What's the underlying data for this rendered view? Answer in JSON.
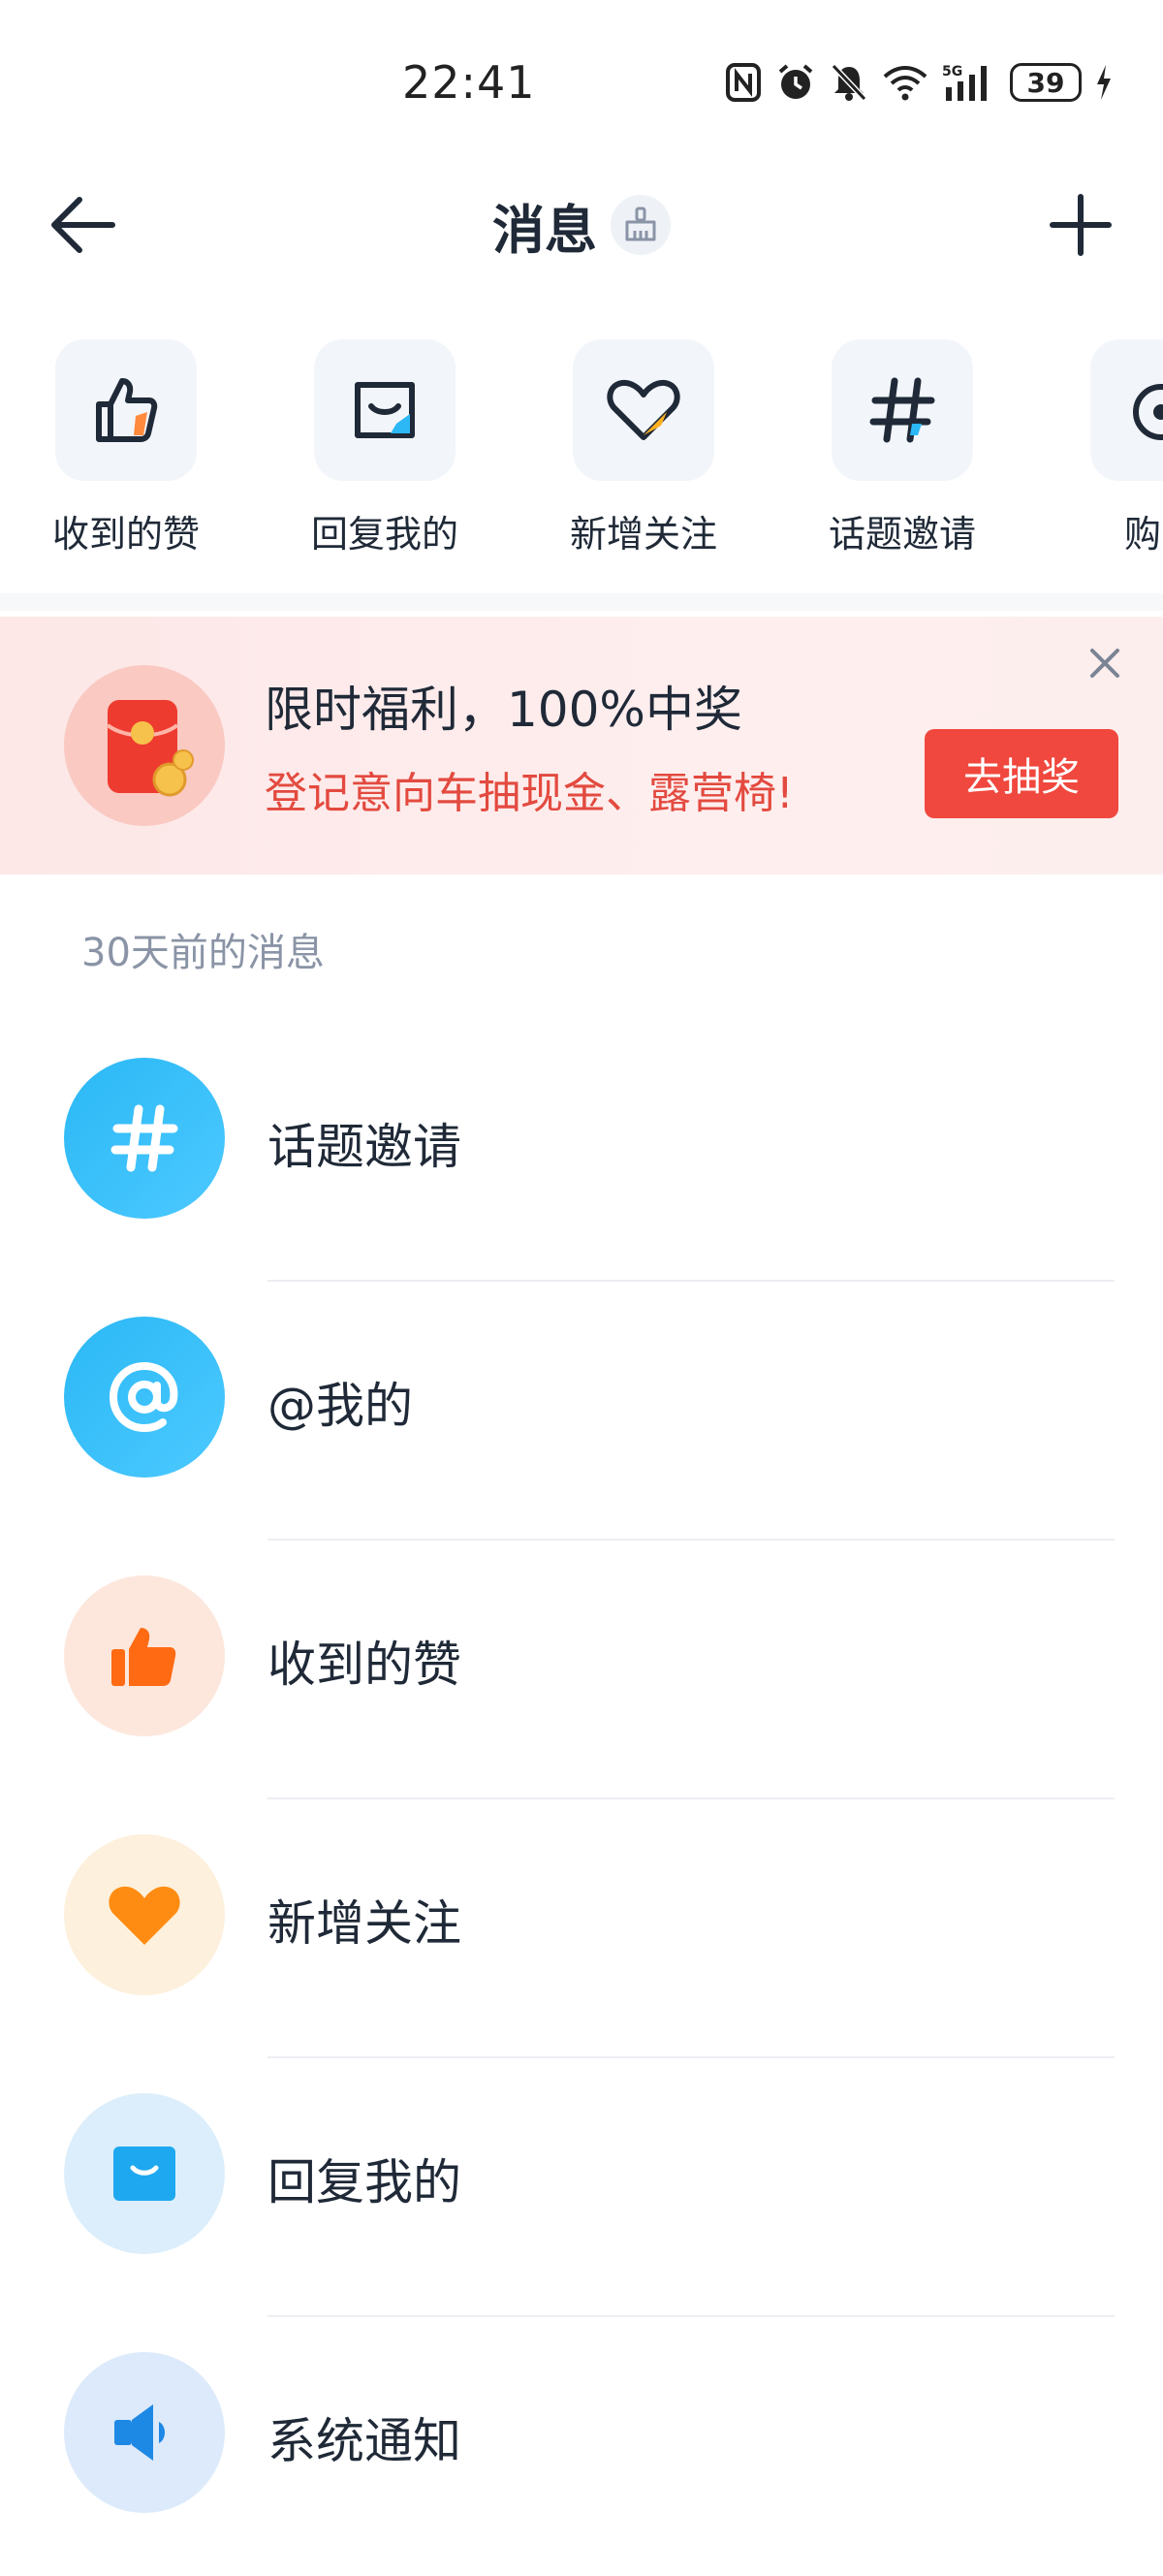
{
  "status_bar": {
    "time": "22:41",
    "battery": "39",
    "icons": [
      "nfc-icon",
      "alarm-icon",
      "mute-icon",
      "wifi-icon",
      "signal-5g-icon",
      "battery-icon",
      "charging-icon"
    ]
  },
  "nav": {
    "title": "消息",
    "back_icon": "arrow-left-icon",
    "sweep_icon": "broom-icon",
    "add_icon": "plus-icon"
  },
  "quick_entries": [
    {
      "label": "收到的赞",
      "icon": "thumbs-up-icon"
    },
    {
      "label": "回复我的",
      "icon": "inbox-icon"
    },
    {
      "label": "新增关注",
      "icon": "heart-icon"
    },
    {
      "label": "话题邀请",
      "icon": "hashtag-icon"
    },
    {
      "label": "购车",
      "icon": "car-icon"
    }
  ],
  "promo": {
    "title": "限时福利，100%中奖",
    "subtitle": "登记意向车抽现金、露营椅!",
    "button": "去抽奖",
    "close_icon": "close-icon"
  },
  "section_header": "30天前的消息",
  "messages": [
    {
      "label": "话题邀请",
      "icon": "hashtag-icon",
      "color": "#2bb8f5"
    },
    {
      "label": "@我的",
      "icon": "at-icon",
      "color": "#2bb8f5"
    },
    {
      "label": "收到的赞",
      "icon": "thumbs-up-icon",
      "color": "#ff7a1a"
    },
    {
      "label": "新增关注",
      "icon": "heart-icon",
      "color": "#ff9a1f"
    },
    {
      "label": "回复我的",
      "icon": "inbox-icon",
      "color": "#1ea8f0"
    },
    {
      "label": "系统通知",
      "icon": "speaker-icon",
      "color": "#1e88e5"
    }
  ],
  "colors": {
    "accent_red": "#f0483e",
    "promo_text": "#e34a3f",
    "muted": "#8a94a6"
  }
}
